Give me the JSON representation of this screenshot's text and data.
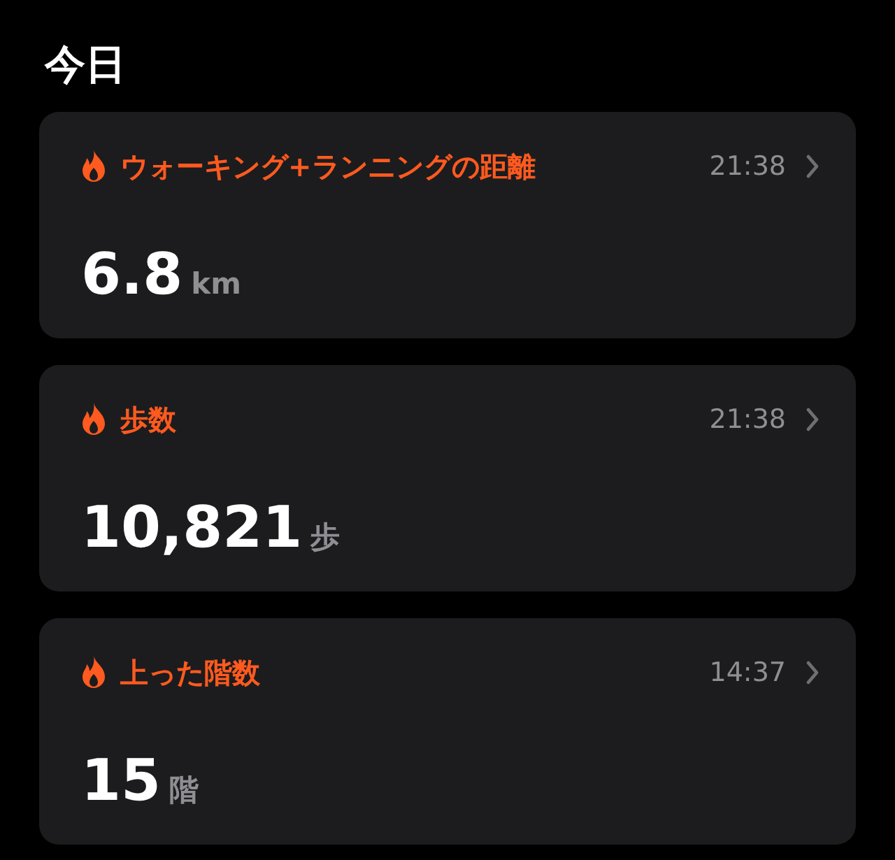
{
  "title": "今日",
  "cards": [
    {
      "label": "ウォーキング+ランニングの距離",
      "time": "21:38",
      "value": "6.8",
      "unit": "km"
    },
    {
      "label": "歩数",
      "time": "21:38",
      "value": "10,821",
      "unit": "歩"
    },
    {
      "label": "上った階数",
      "time": "14:37",
      "value": "15",
      "unit": "階"
    }
  ]
}
